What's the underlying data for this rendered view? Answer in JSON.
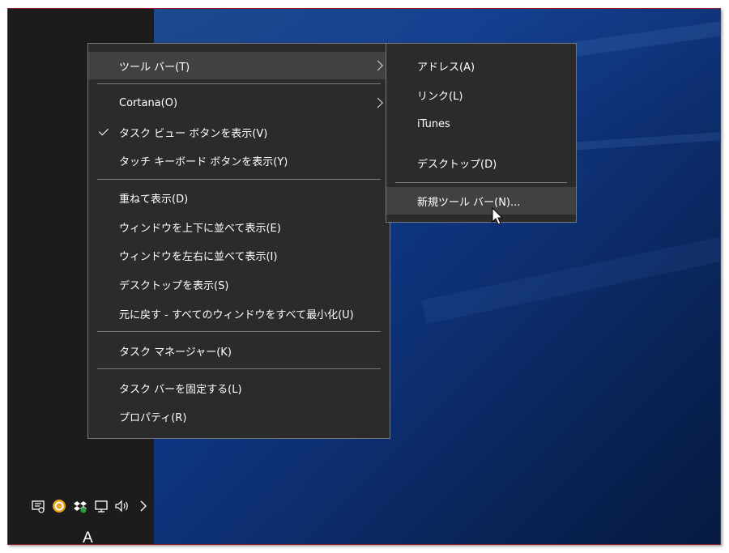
{
  "context_menu": {
    "items": [
      {
        "label": "ツール バー(T)",
        "has_submenu": true,
        "checked": false,
        "highlighted": true
      },
      {
        "label": "Cortana(O)",
        "has_submenu": true,
        "checked": false
      },
      {
        "label": "タスク ビュー ボタンを表示(V)",
        "has_submenu": false,
        "checked": true
      },
      {
        "label": "タッチ キーボード ボタンを表示(Y)",
        "has_submenu": false,
        "checked": false
      },
      {
        "label": "重ねて表示(D)"
      },
      {
        "label": "ウィンドウを上下に並べて表示(E)"
      },
      {
        "label": "ウィンドウを左右に並べて表示(I)"
      },
      {
        "label": "デスクトップを表示(S)"
      },
      {
        "label": "元に戻す - すべてのウィンドウをすべて最小化(U)"
      },
      {
        "label": "タスク マネージャー(K)"
      },
      {
        "label": "タスク バーを固定する(L)"
      },
      {
        "label": "プロパティ(R)"
      }
    ]
  },
  "toolbar_submenu": {
    "items": [
      {
        "label": "アドレス(A)"
      },
      {
        "label": "リンク(L)"
      },
      {
        "label": "iTunes"
      },
      {
        "label": "デスクトップ(D)"
      },
      {
        "label": "新規ツール バー(N)...",
        "highlighted": true
      }
    ]
  },
  "taskbar": {
    "tray_icons": [
      "action-center-icon",
      "app-orange-icon",
      "dropbox-icon",
      "network-icon",
      "volume-icon",
      "chevron-right-icon"
    ],
    "ime_indicator": "A"
  },
  "colors": {
    "menu_bg": "#2b2b2b",
    "menu_highlight": "#414141",
    "menu_border": "#787878",
    "taskbar_bg": "#1c1c1c",
    "desktop_blue": "#0d2f72",
    "frame_border": "#8a1f2a"
  }
}
